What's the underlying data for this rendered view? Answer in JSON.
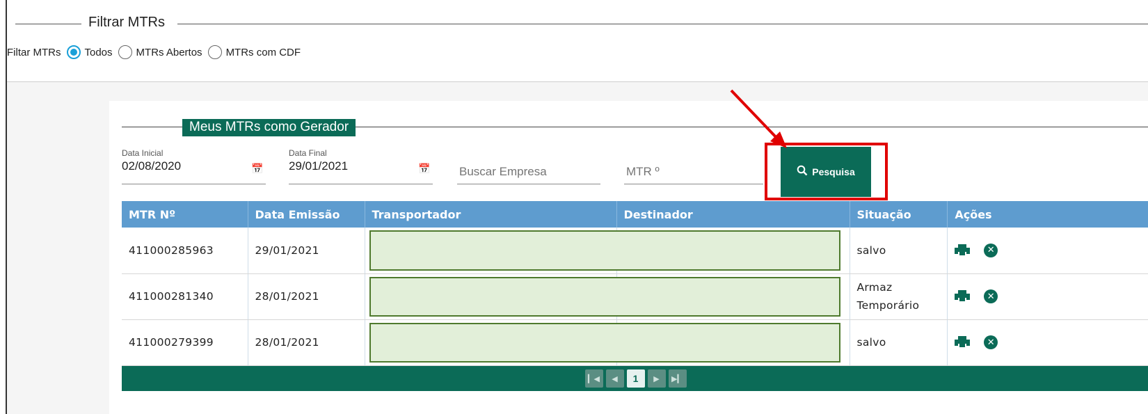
{
  "filter": {
    "legend": "Filtrar MTRs",
    "label": "Filtar MTRs",
    "options": [
      "Todos",
      "MTRs Abertos",
      "MTRs com CDF"
    ],
    "selected": "Todos"
  },
  "section": {
    "title": "Meus MTRs como Gerador"
  },
  "search": {
    "start_caption": "Data Inicial",
    "start_value": "02/08/2020",
    "end_caption": "Data Final",
    "end_value": "29/01/2021",
    "company_placeholder": "Buscar Empresa",
    "mtr_placeholder": "MTR º",
    "button_label": "Pesquisa"
  },
  "table": {
    "headers": [
      "MTR Nº",
      "Data Emissão",
      "Transportador",
      "Destinador",
      "Situação",
      "Ações"
    ],
    "rows": [
      {
        "mtr": "411000285963",
        "date": "29/01/2021",
        "status": "salvo"
      },
      {
        "mtr": "411000281340",
        "date": "28/01/2021",
        "status": "Armaz Temporário"
      },
      {
        "mtr": "411000279399",
        "date": "28/01/2021",
        "status": "salvo"
      }
    ]
  },
  "pager": {
    "current_page": "1",
    "buttons": [
      "first-page",
      "previous-page",
      "next-page",
      "last-page"
    ]
  },
  "colors": {
    "primary": "#0b6b57",
    "header": "#5e9ccf",
    "radio_active": "#1aa0d8",
    "highlight": "#e00000",
    "mask_fill": "#e2efd9"
  },
  "icons": [
    "calendar-icon",
    "search-icon",
    "print-icon",
    "delete-icon",
    "red-arrow-annotation"
  ]
}
